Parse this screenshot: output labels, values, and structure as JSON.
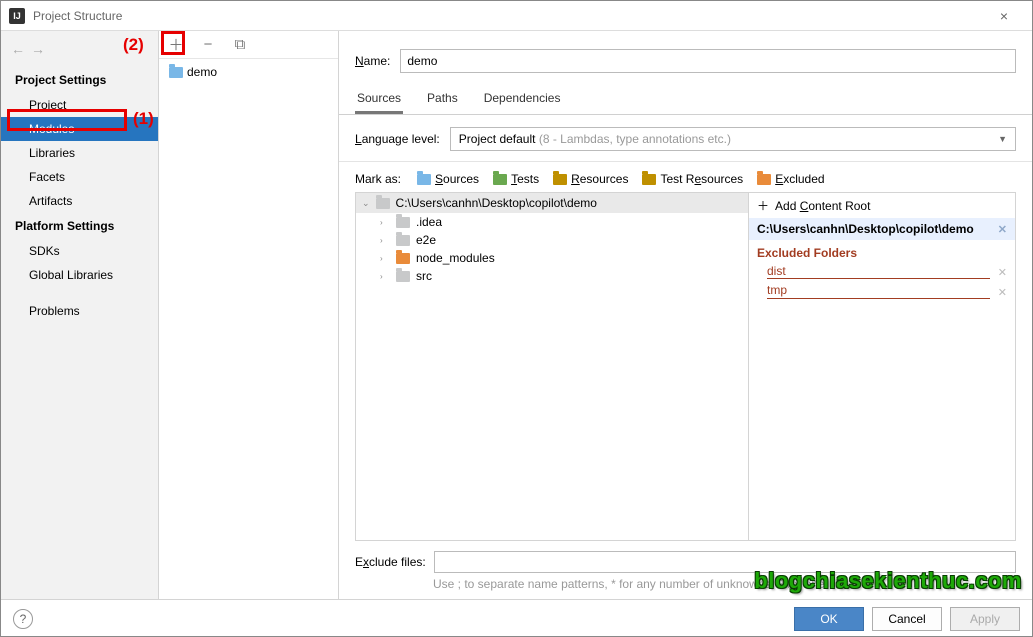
{
  "window": {
    "title": "Project Structure"
  },
  "annotations": {
    "label1": "(1)",
    "label2": "(2)"
  },
  "sidebar": {
    "section1": "Project Settings",
    "items1": [
      "Project",
      "Modules",
      "Libraries",
      "Facets",
      "Artifacts"
    ],
    "section2": "Platform Settings",
    "items2": [
      "SDKs",
      "Global Libraries"
    ],
    "items3": [
      "Problems"
    ],
    "selected": "Modules"
  },
  "modules": {
    "list": [
      "demo"
    ]
  },
  "main": {
    "name_label": "Name:",
    "name_value": "demo",
    "tabs": [
      "Sources",
      "Paths",
      "Dependencies"
    ],
    "active_tab": "Sources",
    "lang_label": "Language level:",
    "lang_value": "Project default",
    "lang_hint": "(8 - Lambdas, type annotations etc.)",
    "mark_label": "Mark as:",
    "mark_items": [
      {
        "label": "Sources",
        "u": "S",
        "rest": "ources",
        "color": "#79b7e7"
      },
      {
        "label": "Tests",
        "u": "T",
        "rest": "ests",
        "color": "#6aa84f"
      },
      {
        "label": "Resources",
        "u": "R",
        "rest": "esources",
        "color": "#bf9000"
      },
      {
        "label": "Test Resources",
        "u": "",
        "rest": "Test Resources",
        "color": "#bf9000"
      },
      {
        "label": "Excluded",
        "u": "E",
        "rest": "xcluded",
        "color": "#e98b3a"
      }
    ],
    "tree_root": "C:\\Users\\canhn\\Desktop\\copilot\\demo",
    "tree_items": [
      {
        "name": ".idea",
        "color": "grey"
      },
      {
        "name": "e2e",
        "color": "grey"
      },
      {
        "name": "node_modules",
        "color": "orange"
      },
      {
        "name": "src",
        "color": "grey"
      }
    ],
    "add_root": "Add Content Root",
    "root_path": "C:\\Users\\canhn\\Desktop\\copilot\\demo",
    "excluded_head": "Excluded Folders",
    "excluded": [
      "dist",
      "tmp"
    ],
    "exclude_label": "Exclude files:",
    "exclude_hint": "Use ; to separate name patterns, * for any number of unknowns, ? for one."
  },
  "footer": {
    "ok": "OK",
    "cancel": "Cancel",
    "apply": "Apply"
  },
  "watermark": "blogchiasekienthuc.com"
}
